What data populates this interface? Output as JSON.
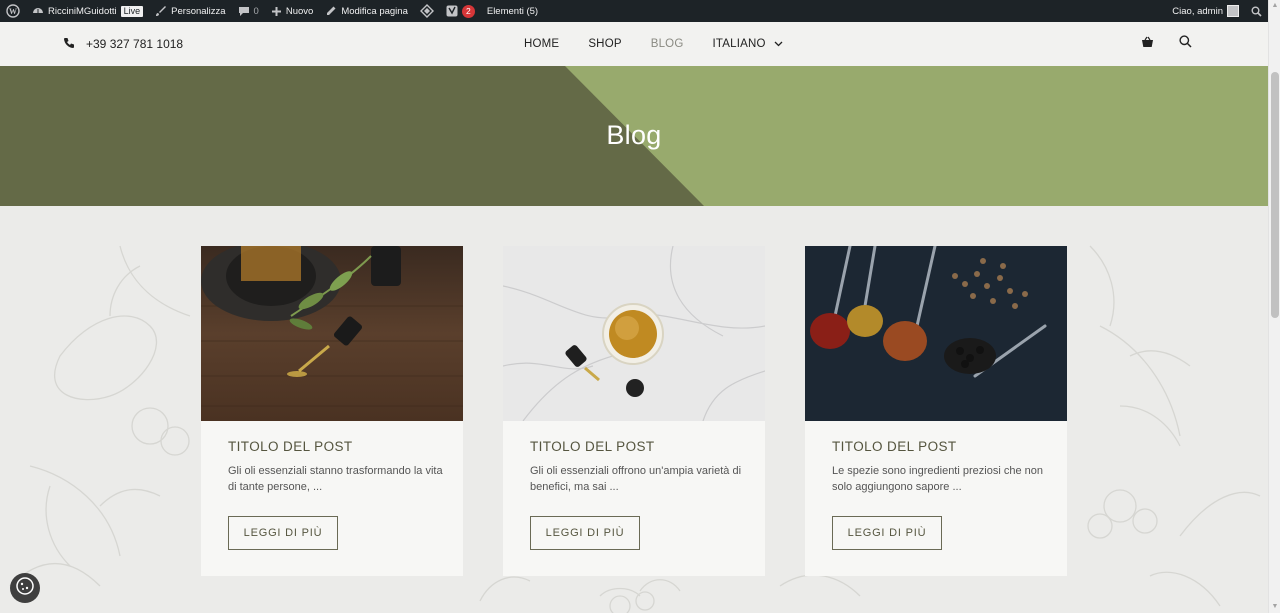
{
  "admin_bar": {
    "site_name": "RicciniMGuidotti",
    "live_badge": "Live",
    "customize": "Personalizza",
    "comments_count": "0",
    "new": "Nuovo",
    "edit_page": "Modifica pagina",
    "updates_count": "2",
    "elements": "Elementi (5)",
    "greeting": "Ciao, admin"
  },
  "header": {
    "phone": "+39 327 781 1018",
    "nav": [
      {
        "label": "HOME"
      },
      {
        "label": "SHOP"
      },
      {
        "label": "BLOG"
      },
      {
        "label": "ITALIANO"
      }
    ]
  },
  "hero": {
    "title": "Blog",
    "colors": {
      "dark": "#646a47",
      "light": "#98aa6d"
    }
  },
  "posts": [
    {
      "title": "TITOLO DEL POST",
      "excerpt": "Gli oli essenziali stanno trasformando la vita di tante persone, ...",
      "button": "LEGGI DI PIÙ",
      "image": "essential-oil-dropper-on-wood"
    },
    {
      "title": "TITOLO DEL POST",
      "excerpt": "Gli oli essenziali offrono un'ampia varietà di benefici, ma sai ...",
      "button": "LEGGI DI PIÙ",
      "image": "oil-glass-on-marble"
    },
    {
      "title": "TITOLO DEL POST",
      "excerpt": "Le spezie sono ingredienti preziosi che non solo aggiungono sapore ...",
      "button": "LEGGI DI PIÙ",
      "image": "spices-in-spoons"
    }
  ],
  "icons": [
    "wordpress-icon",
    "dashboard-icon",
    "brush-icon",
    "comment-icon",
    "plus-icon",
    "pencil-icon",
    "diamond-icon",
    "yoast-icon",
    "avatar",
    "search-icon",
    "phone-icon",
    "chevron-down-icon",
    "basket-icon",
    "cookie-icon"
  ]
}
